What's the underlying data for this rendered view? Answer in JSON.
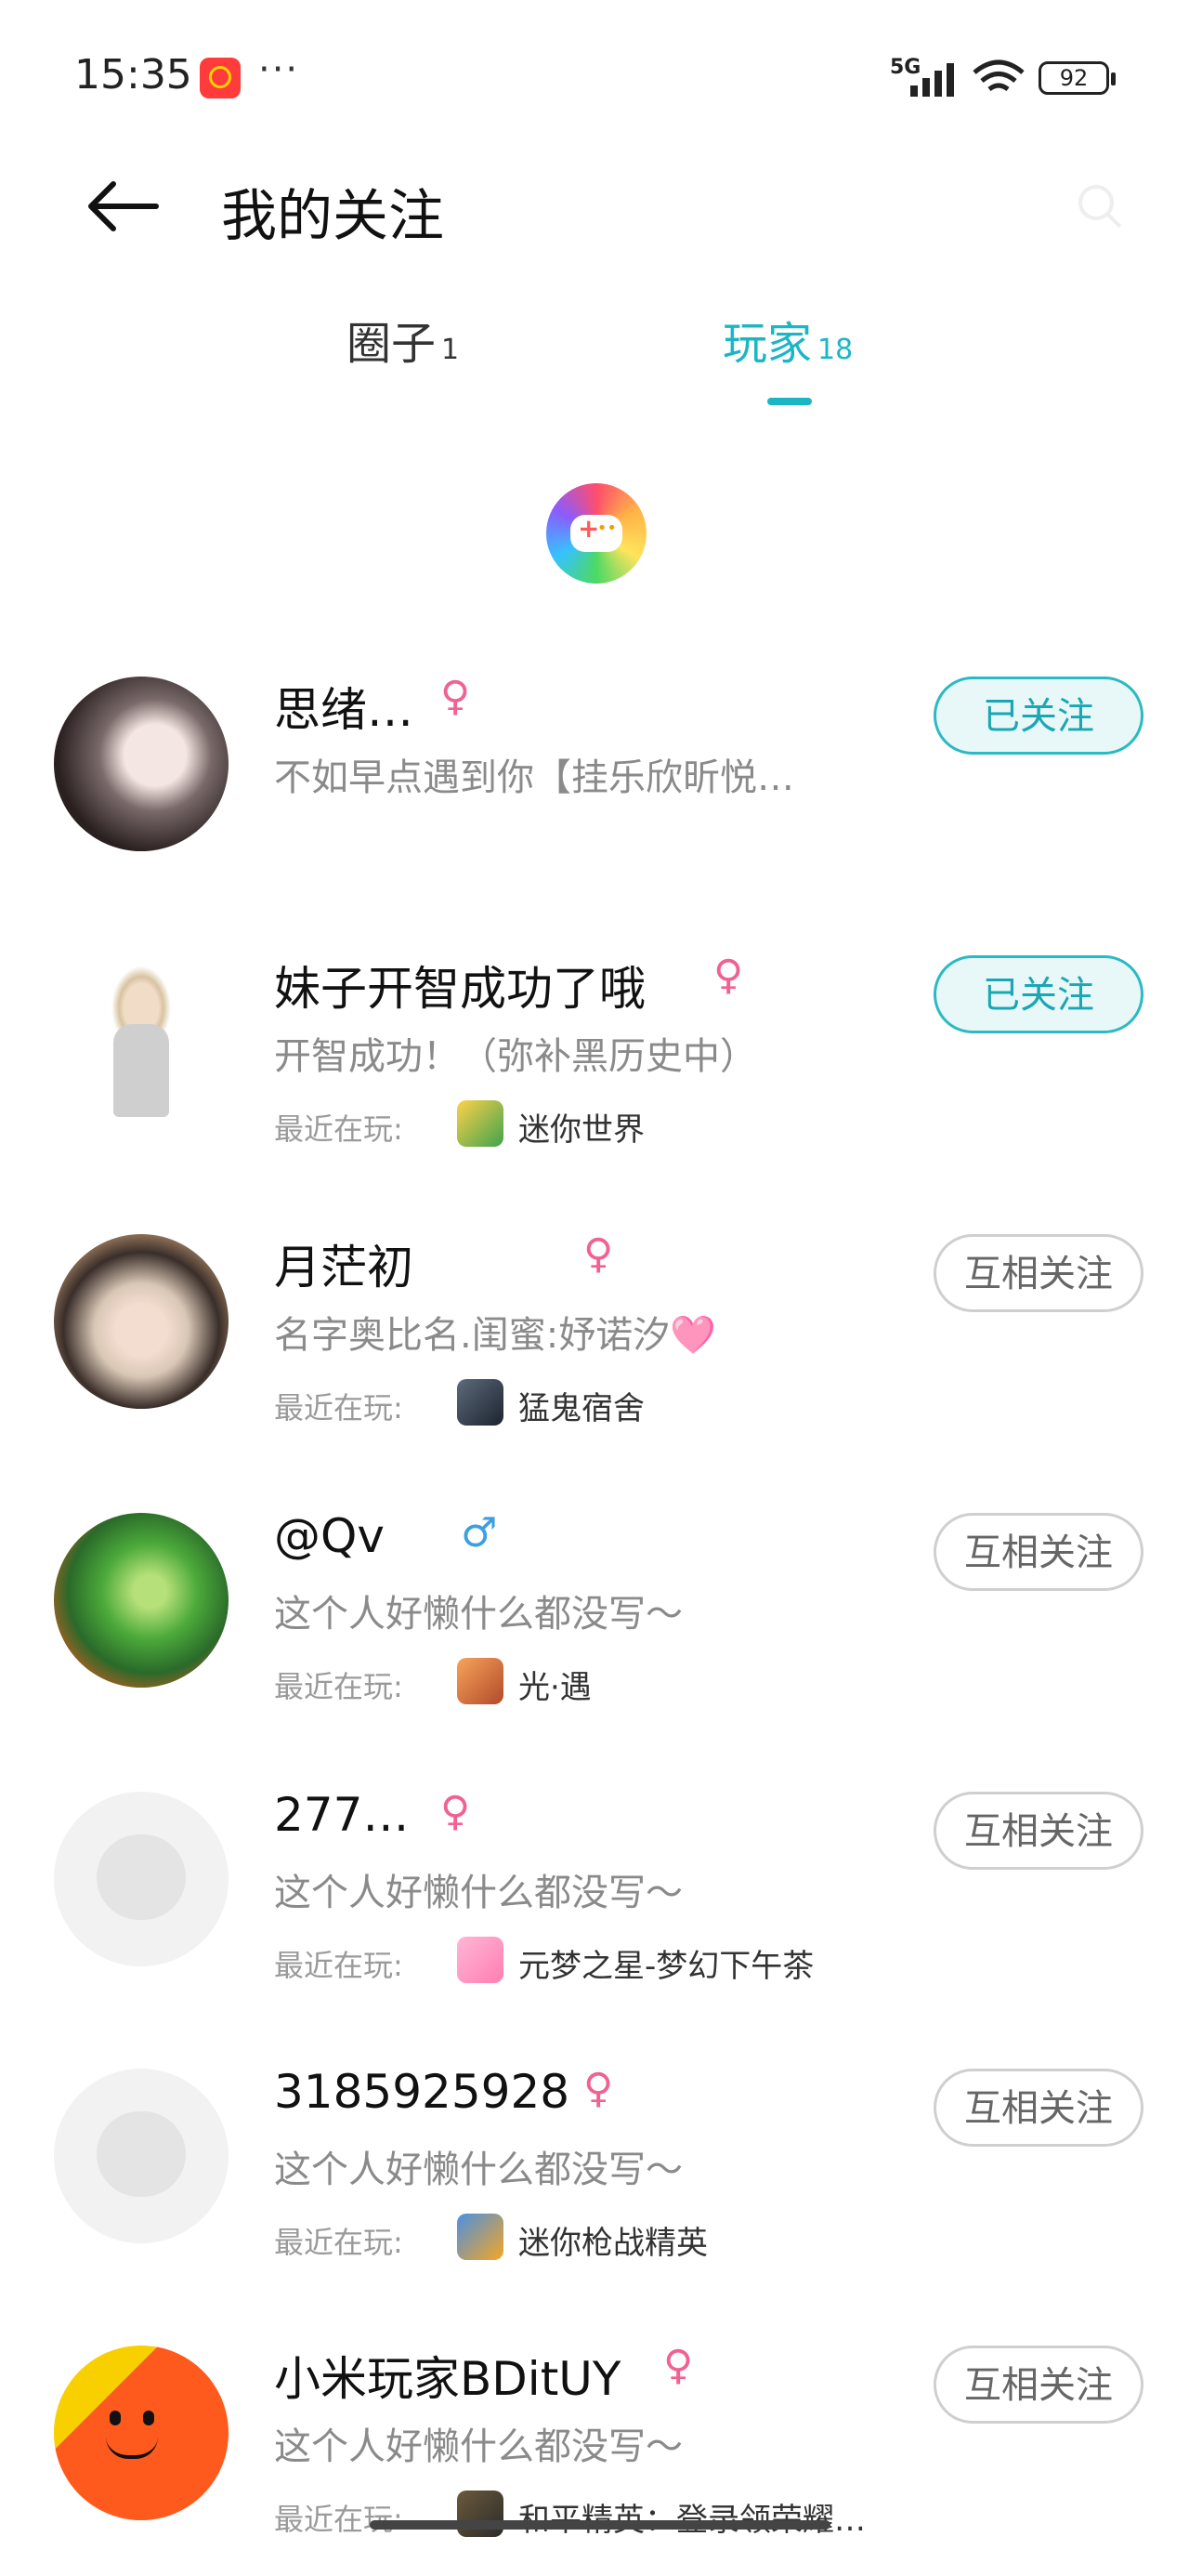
{
  "status_bar": {
    "time": "15:35",
    "dots": "···",
    "network": "5G",
    "battery": "92"
  },
  "header": {
    "title": "我的关注"
  },
  "tabs": [
    {
      "label": "圈子",
      "count": "1"
    },
    {
      "label": "玩家",
      "count": "18"
    }
  ],
  "recent_label": "最近在玩:",
  "users": [
    {
      "name": "思绪…",
      "gender": "♀",
      "bio": "不如早点遇到你【挂乐欣昕悦…",
      "game": "",
      "button": "已关注"
    },
    {
      "name": "妹子开智成功了哦",
      "gender": "♀",
      "bio": "开智成功！（弥补黑历史中）",
      "game": "迷你世界",
      "button": "已关注"
    },
    {
      "name": "月茫初",
      "gender": "♀",
      "bio": "名字奥比名.闺蜜:妤诺汐🩷",
      "game": "猛鬼宿舍",
      "button": "互相关注"
    },
    {
      "name": "@Qv",
      "gender": "♂",
      "bio": "这个人好懒什么都没写～",
      "game": "光·遇",
      "button": "互相关注"
    },
    {
      "name": "277…",
      "gender": "♀",
      "bio": "这个人好懒什么都没写～",
      "game": "元梦之星-梦幻下午茶",
      "button": "互相关注"
    },
    {
      "name": "3185925928",
      "gender": "♀",
      "bio": "这个人好懒什么都没写～",
      "game": "迷你枪战精英",
      "button": "互相关注"
    },
    {
      "name": "小米玩家BDitUY",
      "gender": "♀",
      "bio": "这个人好懒什么都没写～",
      "game": "和平精英：登录领荣耀…",
      "button": "互相关注"
    }
  ]
}
